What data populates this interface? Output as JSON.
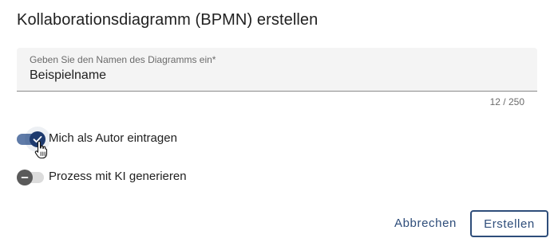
{
  "dialog": {
    "title": "Kollaborationsdiagramm (BPMN) erstellen"
  },
  "name_field": {
    "label": "Geben Sie den Namen des Diagramms ein*",
    "value": "Beispielname",
    "counter": "12 / 250"
  },
  "toggles": [
    {
      "label": "Mich als Autor eintragen",
      "state": "on",
      "icon": "check-icon"
    },
    {
      "label": "Prozess mit KI generieren",
      "state": "off",
      "icon": "minus-icon"
    }
  ],
  "actions": {
    "cancel_label": "Abbrechen",
    "create_label": "Erstellen"
  },
  "colors": {
    "primary": "#2e4d7a",
    "toggle_on_thumb": "#1d3a6e",
    "toggle_on_track": "#5f7ba8",
    "toggle_off_thumb": "#5a5a5a",
    "toggle_off_track": "#dcdcdc",
    "field_background": "#f4f4f4"
  }
}
